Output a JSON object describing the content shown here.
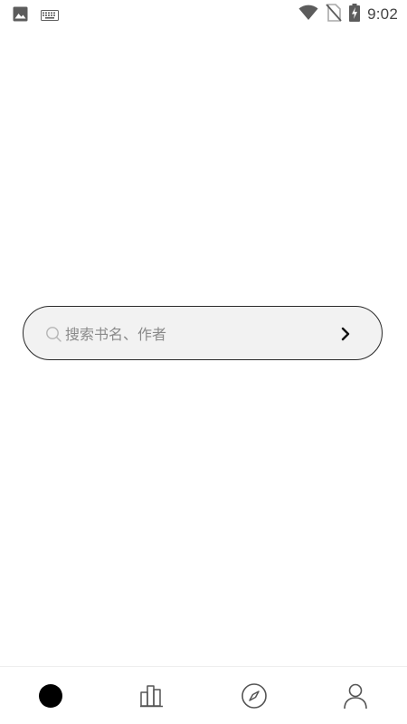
{
  "status_bar": {
    "time": "9:02",
    "left_icons": [
      "image-icon",
      "keyboard-icon"
    ],
    "right_icons": [
      "wifi-icon",
      "no-sim-icon",
      "battery-charging-icon"
    ]
  },
  "search": {
    "placeholder": "搜索书名、作者",
    "value": "",
    "icon": "search-icon",
    "submit_icon": "chevron-right-icon"
  },
  "bottom_nav": {
    "items": [
      {
        "name": "home",
        "icon": "home-dot-icon",
        "active": true
      },
      {
        "name": "bookshelf",
        "icon": "books-icon",
        "active": false
      },
      {
        "name": "discover",
        "icon": "compass-icon",
        "active": false
      },
      {
        "name": "profile",
        "icon": "user-icon",
        "active": false
      }
    ]
  },
  "colors": {
    "background": "#ffffff",
    "search_fill": "#f2f2f2",
    "search_border": "#2a2a2a",
    "placeholder": "#8a8a8a",
    "nav_icon": "#555555",
    "active": "#000000"
  }
}
